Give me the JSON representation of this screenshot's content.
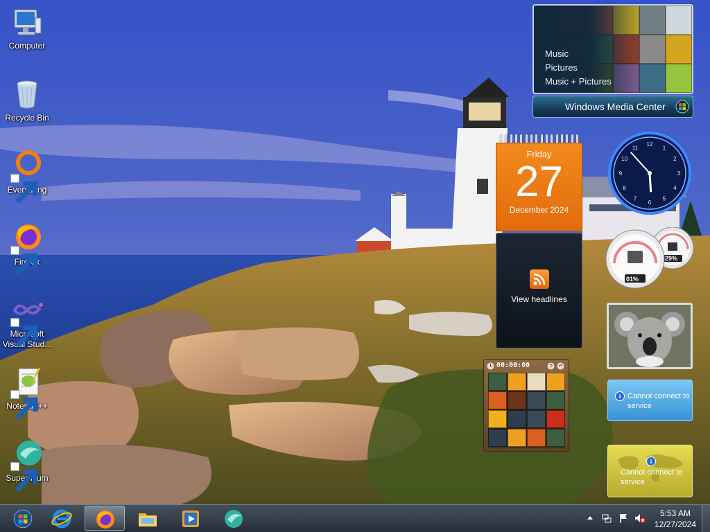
{
  "desktop": {
    "icons": [
      {
        "label": "Computer",
        "icon": "computer-icon",
        "shortcut": false
      },
      {
        "label": "Recycle Bin",
        "icon": "recycle-bin-icon",
        "shortcut": false
      },
      {
        "label": "Everything",
        "icon": "everything-icon",
        "shortcut": true
      },
      {
        "label": "Firefox",
        "icon": "firefox-icon",
        "shortcut": true
      },
      {
        "label": "Microsoft Visual Stud...",
        "icon": "visual-studio-icon",
        "shortcut": true
      },
      {
        "label": "Notepad++",
        "icon": "notepad-plus-plus-icon",
        "shortcut": true
      },
      {
        "label": "Supermium",
        "icon": "supermium-icon",
        "shortcut": true
      }
    ]
  },
  "gadgets": {
    "media_center": {
      "menu": [
        "Music",
        "Pictures",
        "Music + Pictures"
      ],
      "title": "Windows Media Center"
    },
    "calendar": {
      "weekday": "Friday",
      "day": "27",
      "month_year": "December 2024"
    },
    "feed_headlines": {
      "label": "View headlines"
    },
    "clock": {
      "hour": 5,
      "minute": 53
    },
    "cpu_meter": {
      "cpu": "01%",
      "memory": "29%"
    },
    "weather": {
      "message": "Cannot connect to service"
    },
    "currency": {
      "message": "Cannot connect to service"
    },
    "picture_puzzle": {
      "timer": "00:00:00"
    }
  },
  "taskbar": {
    "pinned": [
      {
        "name": "start-button",
        "icon": "windows-orb-icon"
      },
      {
        "name": "internet-explorer",
        "icon": "internet-explorer-icon"
      },
      {
        "name": "firefox",
        "icon": "firefox-icon",
        "active": true
      },
      {
        "name": "windows-explorer",
        "icon": "folder-icon"
      },
      {
        "name": "windows-media-player",
        "icon": "media-player-icon"
      },
      {
        "name": "supermium",
        "icon": "supermium-icon"
      }
    ],
    "tray": {
      "time": "5:53 AM",
      "date": "12/27/2024",
      "icons": [
        "show-hidden-icons-icon",
        "network-icon",
        "action-center-flag-icon",
        "volume-muted-icon"
      ]
    }
  },
  "colors": {
    "calendar_orange": "#e8720f",
    "taskbar": "#2a3645",
    "weather_blue": "#3593d8",
    "currency_yellow": "#c8bd38"
  }
}
